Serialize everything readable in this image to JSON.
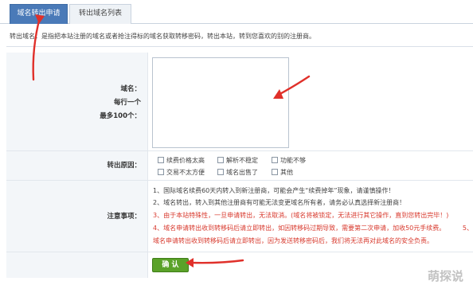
{
  "tabs": [
    {
      "label": "域名转出申请",
      "active": true
    },
    {
      "label": "转出域名列表",
      "active": false
    }
  ],
  "description": "转出域名：是指把本站注册的域名或者抢注得标的域名获取转移密码，转出本站，转到您喜欢的别的注册商。",
  "form": {
    "domain_label_lines": [
      "域名：",
      "每行一个",
      "最多100个："
    ],
    "domain_value": "",
    "reason_label": "转出原因：",
    "reasons": [
      "续费价格太高",
      "解析不稳定",
      "功能不够",
      "交易不太方便",
      "域名出售了",
      "其他"
    ],
    "notes_label": "注意事项：",
    "notes": [
      {
        "text": "1、国际域名续费60天内转入到新注册商，可能会产生“续费掉年”现象，请谨慎操作！",
        "red": false
      },
      {
        "text": "2、域名转出，转入到其他注册商有可能无法变更域名所有者，请务必认真选择新注册商！",
        "red": false
      },
      {
        "text": "3、由于本站特殊性，一旦申请转出，无法取消。(域名将被锁定，无法进行其它操作，直到您转出完毕！)",
        "red": true
      },
      {
        "text": "4、域名申请转出收到转移码后请立即转出，如因转移码过期导致，需要第二次申请，加收50元手续费。",
        "red": true
      },
      {
        "text": "   域名申请转出收到转移码后请立即转出，因为发送转移密码后，我们将无法再对此域名的安全负责。",
        "red": true
      }
    ],
    "note5_stub": "5、",
    "submit_label": "确 认"
  },
  "watermark": "萌探说"
}
